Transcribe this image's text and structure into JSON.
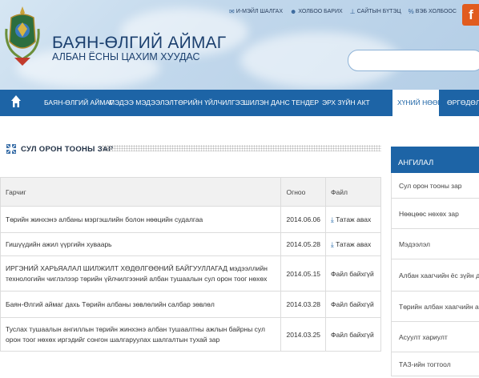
{
  "header": {
    "site_title": "БАЯН-ӨЛГИЙ АЙМАГ",
    "site_subtitle": "АЛБАН ЁСНЫ ЦАХИМ ХУУДАС",
    "top_links": [
      "И-МЭЙЛ ШАЛГАХ",
      "ХОЛБОО БАРИХ",
      "САЙТЫН БҮТЭЦ",
      "ВЭБ ХОЛБООС"
    ],
    "facebook_letter": "f",
    "search_placeholder": ""
  },
  "nav": {
    "items": [
      "БАЯН-ӨЛГИЙ АЙМАГ",
      "МЭДЭЭ МЭДЭЭЛЭЛ",
      "ТӨРИЙН ҮЙЛЧИЛГЭЭ",
      "ШИЛЭН ДАНС",
      "ТЕНДЕР",
      "ЭРХ ЗҮЙН АКТ",
      "ХҮНИЙ НӨӨЦ",
      "ӨРГӨДӨЛ"
    ],
    "active": "ХҮНИЙ НӨӨЦ"
  },
  "section": {
    "title": "СУЛ ОРОН ТООНЫ ЗАР"
  },
  "table": {
    "headers": [
      "Гарчиг",
      "Огноо",
      "Файл"
    ],
    "rows": [
      {
        "title": "Төрийн жинхэнэ албаны мэргэшлийн болон нөөцийн судалгаа",
        "date": "2014.06.06",
        "file": "Татаж авах",
        "download": true
      },
      {
        "title": "Гишүүдийн ажил үүргийн хуваарь",
        "date": "2014.05.28",
        "file": "Татаж авах",
        "download": true
      },
      {
        "title": "ИРГЭНИЙ ХАРЬЯАЛАЛ ШИЛЖИЛТ ХӨДӨЛГӨӨНИЙ БАЙГУУЛЛАГАД мэдээллийн технологийн чиглэлээр төрийн үйлчилгээний албан тушаалын сул орон тоог нөхөх",
        "date": "2014.05.15",
        "file": "Файл байхгүй",
        "download": false
      },
      {
        "title": "Баян-Өлгий аймаг дахь Төрийн албаны зөвлөлийн салбар зөвлөл",
        "date": "2014.03.28",
        "file": "Файл байхгүй",
        "download": false
      },
      {
        "title": "Туслах тушаалын ангиллын төрийн жинхэнэ албан тушаалтны ажлын байрны сул орон тоог нөхөх иргэдийг сонгон шалгаруулах шалгалтын тухай зар",
        "date": "2014.03.25",
        "file": "Файл байхгүй",
        "download": false
      }
    ]
  },
  "sidebar": {
    "title": "АНГИЛАЛ",
    "items": [
      "Сул орон тооны зар",
      "Нөөцөөс нөхөх зар",
      "Мэдээлэл",
      "Албан хаагчийн ёс зүйн дүрэм",
      "Төрийн албан хаагчийн анкет",
      "Асуулт хариулт",
      "ТАЗ-ийн тогтоол"
    ]
  },
  "colors": {
    "primary": "#1d64a6",
    "header_bg": "#c2d8ec",
    "facebook": "#e15b1e"
  },
  "icons": {
    "download": "download-icon",
    "home": "home-icon",
    "section": "grid-icon"
  }
}
